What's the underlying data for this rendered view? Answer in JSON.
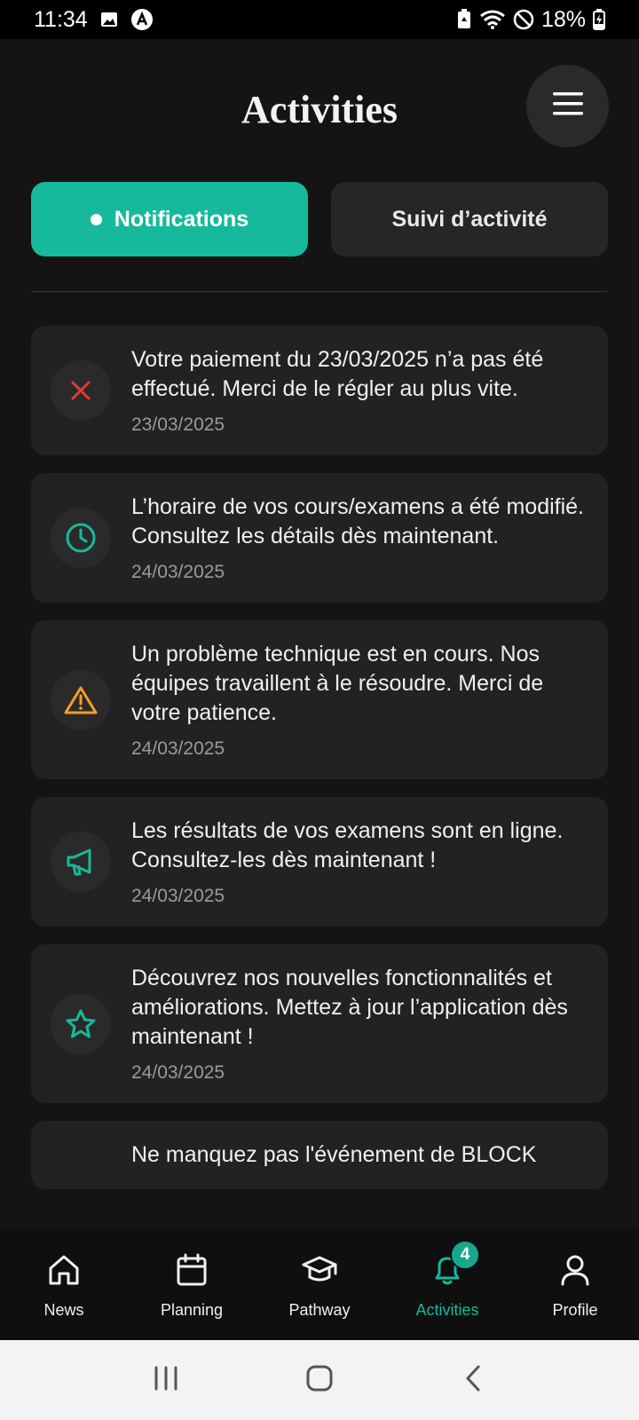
{
  "status_bar": {
    "time": "11:34",
    "battery": "18%"
  },
  "header": {
    "title": "Activities"
  },
  "tabs": [
    {
      "label": "Notifications",
      "active": true
    },
    {
      "label": "Suivi d’activité",
      "active": false
    }
  ],
  "notifications": [
    {
      "icon": "close-icon",
      "icon_color": "#e53935",
      "text": "Votre paiement du 23/03/2025 n’a pas été effectué. Merci de le régler au plus vite.",
      "date": "23/03/2025"
    },
    {
      "icon": "clock-icon",
      "icon_color": "#16b99b",
      "text": "L’horaire de vos cours/examens a été modifié. Consultez les détails dès maintenant.",
      "date": "24/03/2025"
    },
    {
      "icon": "warning-icon",
      "icon_color": "#f2a02c",
      "text": "Un problème technique est en cours. Nos équipes travaillent à le résoudre. Merci de votre patience.",
      "date": "24/03/2025"
    },
    {
      "icon": "megaphone-icon",
      "icon_color": "#16b99b",
      "text": "Les résultats de vos examens sont en ligne. Consultez-les dès maintenant !",
      "date": "24/03/2025"
    },
    {
      "icon": "star-icon",
      "icon_color": "#16b99b",
      "text": "Découvrez nos nouvelles fonctionnalités et améliorations. Mettez à jour l’application dès maintenant !",
      "date": "24/03/2025"
    },
    {
      "icon": "info-icon",
      "icon_color": "#16b99b",
      "text": "Ne manquez pas l'événement de BLOCK",
      "date": ""
    }
  ],
  "bottom_nav": {
    "items": [
      {
        "label": "News",
        "icon": "home-icon"
      },
      {
        "label": "Planning",
        "icon": "calendar-icon"
      },
      {
        "label": "Pathway",
        "icon": "graduation-cap-icon"
      },
      {
        "label": "Activities",
        "icon": "bell-icon",
        "active": true,
        "badge": "4"
      },
      {
        "label": "Profile",
        "icon": "user-icon"
      }
    ]
  },
  "colors": {
    "accent": "#16b99b",
    "background": "#141414",
    "card": "#222222"
  }
}
